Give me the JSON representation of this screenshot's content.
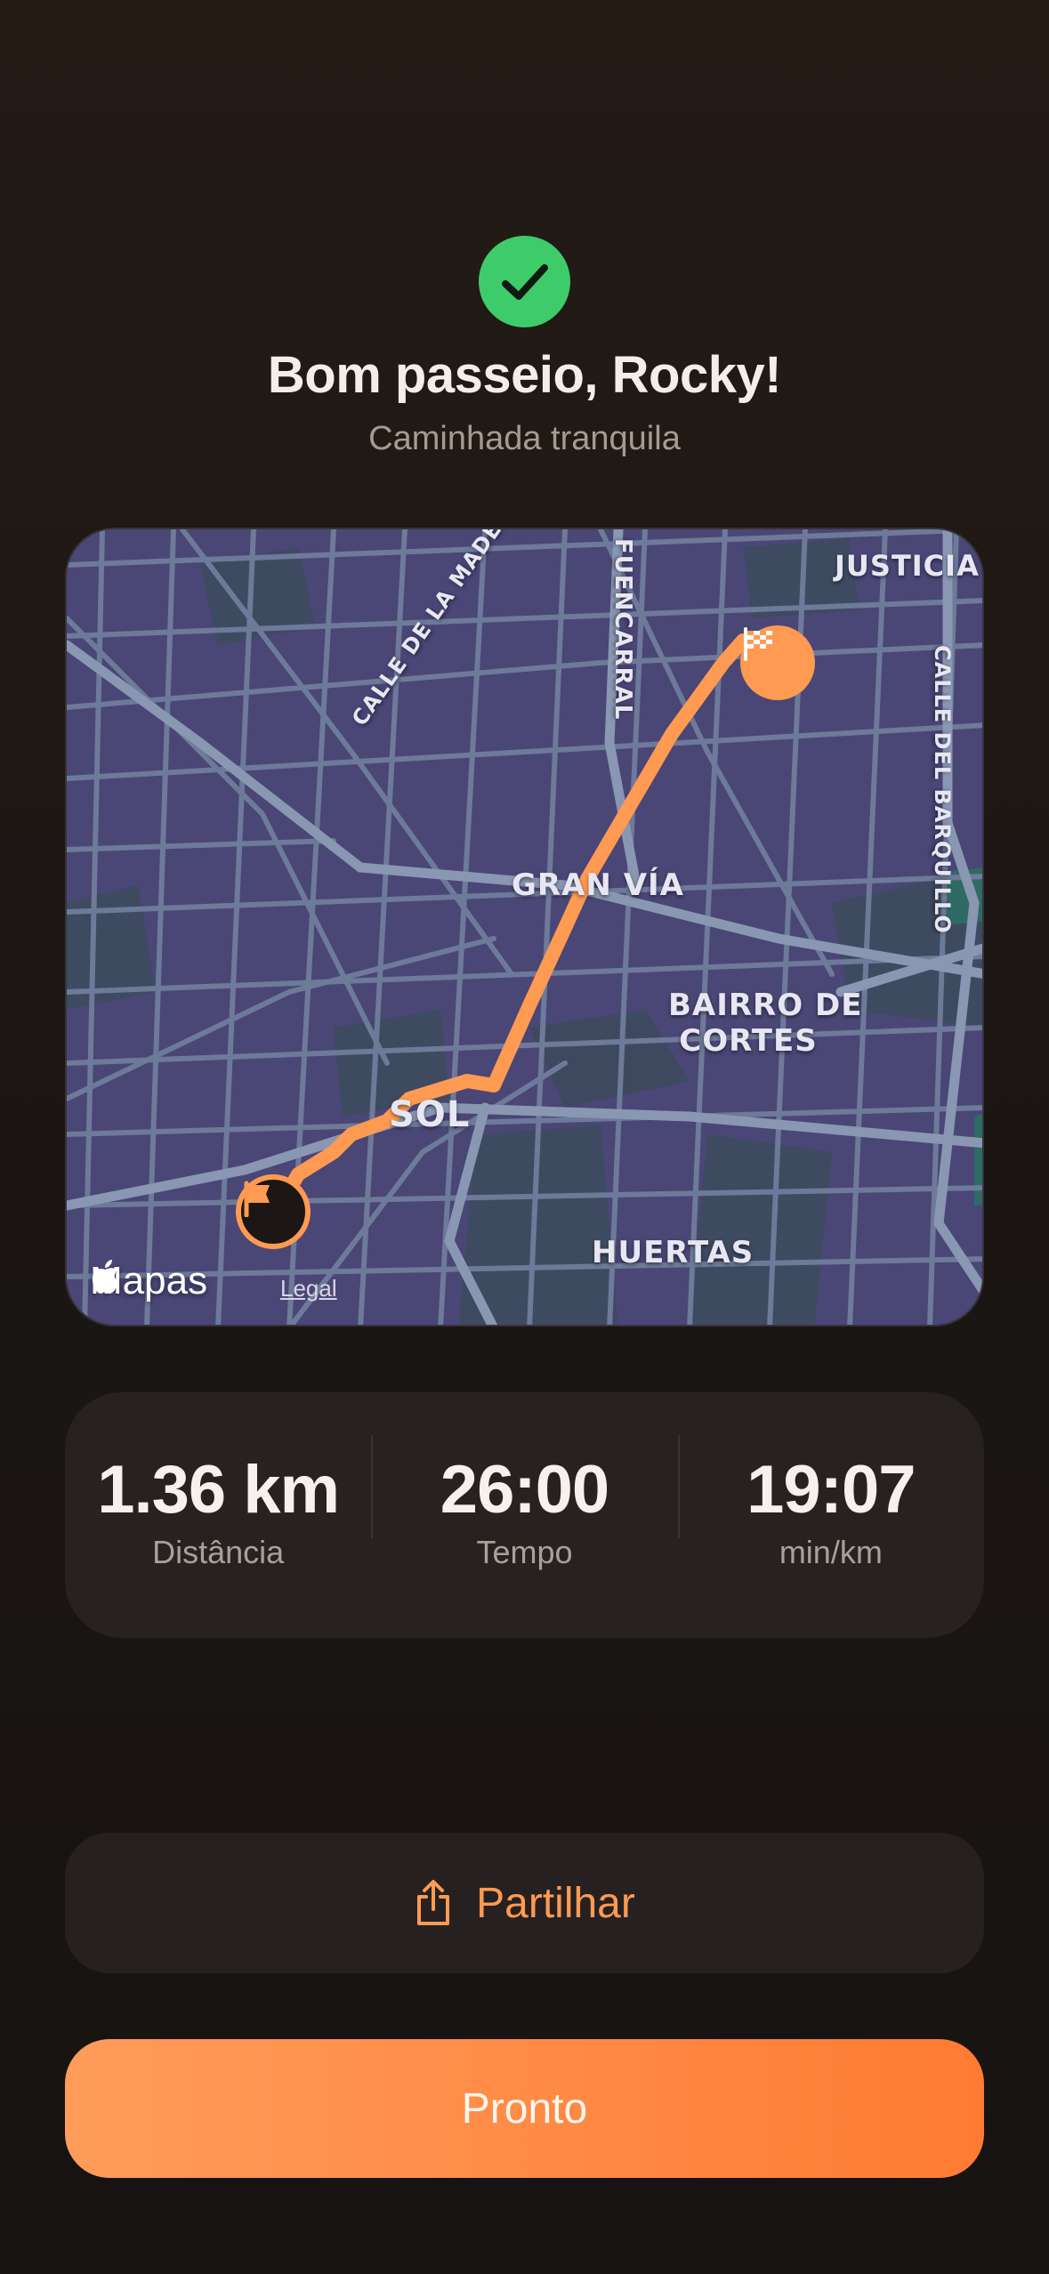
{
  "header": {
    "title": "Bom passeio, Rocky!",
    "subtitle": "Caminhada tranquila",
    "status_icon": "checkmark-icon"
  },
  "map": {
    "labels": {
      "justicia": "JUSTICIA",
      "calle_madera": "CALLE DE LA MADERA",
      "fuencarral": "FUENCARRAL",
      "calle_barquillo": "CALLE DEL BARQUILLO",
      "gran_via": "GRAN VÍA",
      "bairro_cortes_1": "BAIRRO DE",
      "bairro_cortes_2": "CORTES",
      "sol": "SOL",
      "huertas": "HUERTAS"
    },
    "logo_text": "Mapas",
    "legal_text": "Legal",
    "start_icon": "flag-icon",
    "end_icon": "checkered-flag-icon",
    "route_color": "#ff9a52"
  },
  "stats": [
    {
      "value": "1.36 km",
      "label": "Distância"
    },
    {
      "value": "26:00",
      "label": "Tempo"
    },
    {
      "value": "19:07",
      "label": "min/km"
    }
  ],
  "actions": {
    "share_label": "Partilhar",
    "share_icon": "share-icon",
    "done_label": "Pronto"
  },
  "colors": {
    "accent": "#ff8a3d",
    "success": "#3ecb6a",
    "background": "#1c1714"
  }
}
